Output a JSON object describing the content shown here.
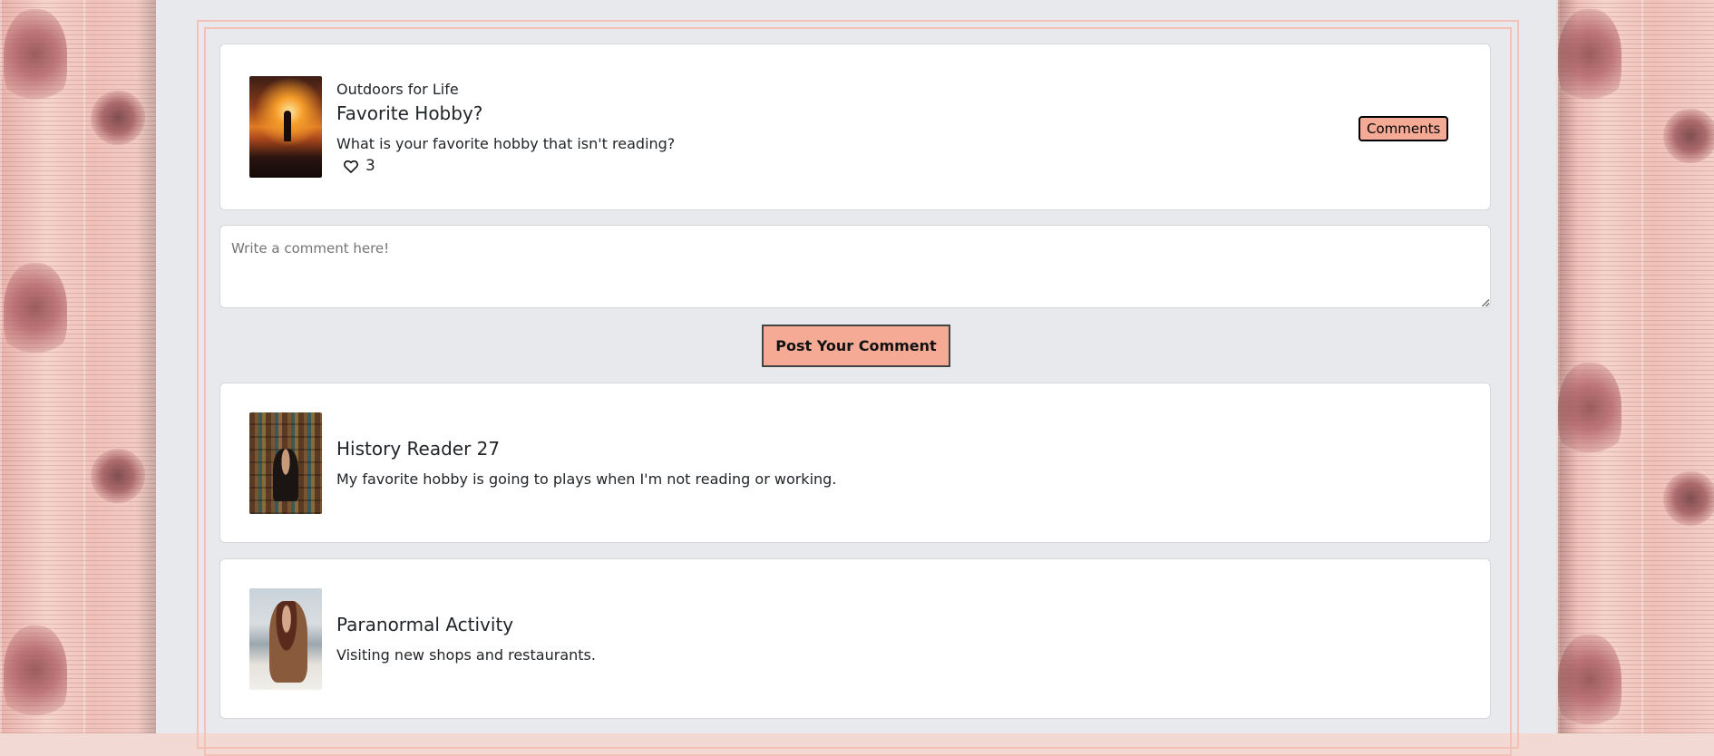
{
  "post": {
    "author": "Outdoors for Life",
    "title": "Favorite Hobby?",
    "body": "What is your favorite hobby that isn't reading?",
    "likes": "3",
    "comments_label": "Comments"
  },
  "comment_form": {
    "placeholder": "Write a comment here!",
    "submit_label": "Post Your Comment"
  },
  "comments": [
    {
      "author": "History Reader 27",
      "body": "My favorite hobby is going to plays when I'm not reading or working."
    },
    {
      "author": "Paranormal Activity",
      "body": "Visiting new shops and restaurants."
    }
  ],
  "colors": {
    "accent": "#f5aa96",
    "frame": "#f4c1b6",
    "page_bg": "#e8e9ed"
  }
}
